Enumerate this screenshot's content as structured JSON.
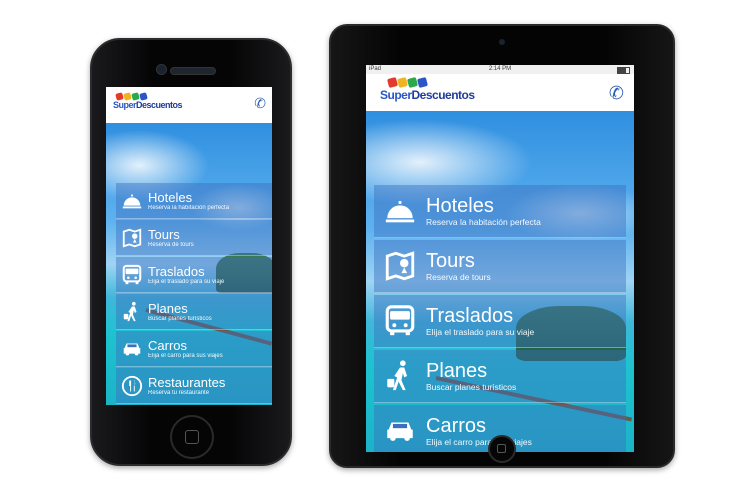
{
  "brand": {
    "logo_part1": "Super",
    "logo_part2": "Descuentos",
    "tag_colors": [
      "#e23b2e",
      "#f0b322",
      "#2aa84a",
      "#2b56c6",
      "#d83a8a"
    ]
  },
  "status_bar": {
    "carrier": "iPad",
    "time": "2:14 PM"
  },
  "header": {
    "call_icon": "phone-icon",
    "accent_color": "#2f5fb0"
  },
  "menu": [
    {
      "id": "hoteles",
      "title": "Hoteles",
      "subtitle": "Reserva la habitación perfecta",
      "icon": "hotel-bell-icon"
    },
    {
      "id": "tours",
      "title": "Tours",
      "subtitle": "Reserva de tours",
      "icon": "map-icon"
    },
    {
      "id": "traslados",
      "title": "Traslados",
      "subtitle": "Elija el traslado para su viaje",
      "icon": "bus-icon"
    },
    {
      "id": "planes",
      "title": "Planes",
      "subtitle": "Buscar planes turísticos",
      "icon": "traveler-icon"
    },
    {
      "id": "carros",
      "title": "Carros",
      "subtitle": "Elija el carro para sus viajes",
      "icon": "car-icon"
    },
    {
      "id": "restaurantes",
      "title": "Restaurantes",
      "subtitle": "Reserva tu restaurante",
      "icon": "restaurant-icon"
    }
  ],
  "colors": {
    "menu_overlay": "#3c6ebe",
    "logo_blue": "#2b56c6"
  }
}
